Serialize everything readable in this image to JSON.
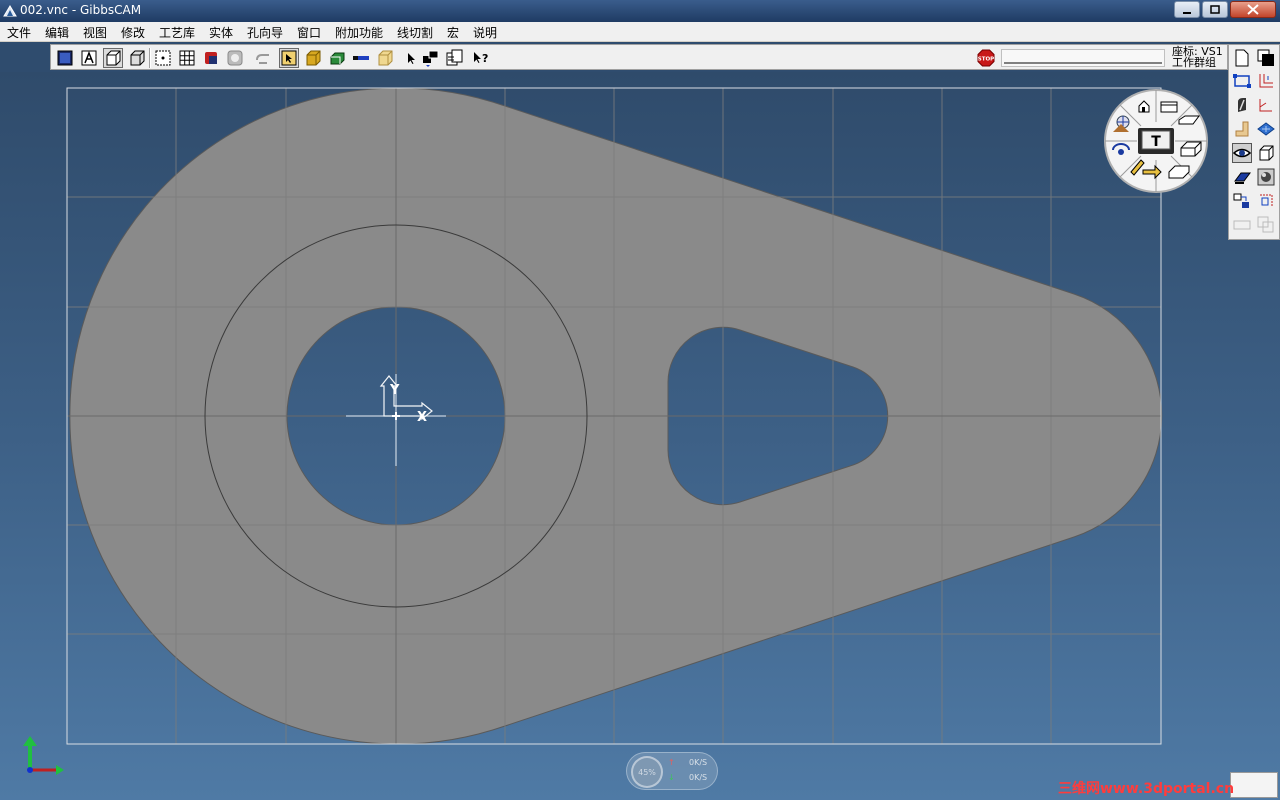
{
  "window": {
    "title": "002.vnc - GibbsCAM",
    "app_icon": "gibbscam-logo-icon",
    "controls": [
      "minimize-icon",
      "restore-icon",
      "close-icon"
    ]
  },
  "menubar": {
    "items": [
      "文件",
      "编辑",
      "视图",
      "修改",
      "工艺库",
      "实体",
      "孔向导",
      "窗口",
      "附加功能",
      "线切割",
      "宏",
      "说明"
    ]
  },
  "toolbar": {
    "icons": [
      "view-front-icon",
      "view-text-icon",
      "view-wireframe-icon",
      "view-shaded-icon",
      "snap-point-icon",
      "grid-icon",
      "part-color-icon",
      "transparent-icon",
      "toolpath-icon",
      "select-solid-icon",
      "solid-gold-icon",
      "solid-green-icon",
      "tool-bar-icon",
      "stock-icon",
      "pointer-icon",
      "workgroup-icon",
      "multi-window-icon",
      "help-cursor-icon"
    ],
    "stop_icon": "stop-sign-icon",
    "coord_label": "座标: VS1",
    "group_label": "工作群组"
  },
  "right_palette": {
    "icons": [
      "new-doc-icon",
      "copy-window-icon",
      "rectangle-icon",
      "axis-lines-icon",
      "cut-icon",
      "corner-icon",
      "elbow-icon",
      "plane-icon",
      "eye-view-icon",
      "cube-icon",
      "plane-blue-icon",
      "render-icon",
      "transform-icon",
      "crop-icon",
      "rect-outline-icon",
      "layers-icon"
    ]
  },
  "view_cube": {
    "center_label": "T",
    "icons": [
      "home-icon",
      "hand-pan-icon",
      "rotate-icon",
      "pencil-icon",
      "arrow-icon",
      "box-right-icon",
      "box-front-icon",
      "box-left-icon",
      "box-bottom-icon",
      "box-top-icon"
    ]
  },
  "viewport": {
    "origin_labels": {
      "x": "X",
      "y": "Y"
    },
    "colors": {
      "part": "#8a8a8a",
      "background_top": "#2f4b6b",
      "background_bottom": "#4f7aa5"
    }
  },
  "status": {
    "percent": "45%",
    "up_rate": "0K/S",
    "down_rate": "0K/S"
  },
  "watermark": "三维网www.3dportal.cn"
}
